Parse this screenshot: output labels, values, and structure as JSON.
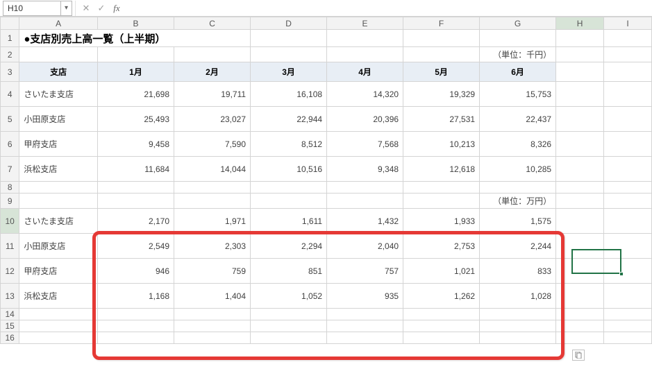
{
  "name_box": {
    "value": "H10"
  },
  "formula_bar": {
    "value": ""
  },
  "columns": [
    "A",
    "B",
    "C",
    "D",
    "E",
    "F",
    "G",
    "H",
    "I"
  ],
  "rows": [
    "1",
    "2",
    "3",
    "4",
    "5",
    "6",
    "7",
    "8",
    "9",
    "10",
    "11",
    "12",
    "13",
    "14",
    "15",
    "16"
  ],
  "title": "●支店別売上高一覧（上半期）",
  "unit_sen": "（単位：千円）",
  "unit_man": "（単位：万円）",
  "headers": {
    "store": "支店",
    "m1": "1月",
    "m2": "2月",
    "m3": "3月",
    "m4": "4月",
    "m5": "5月",
    "m6": "6月"
  },
  "data_sen": [
    {
      "store": "さいたま支店",
      "v": [
        "21,698",
        "19,711",
        "16,108",
        "14,320",
        "19,329",
        "15,753"
      ]
    },
    {
      "store": "小田原支店",
      "v": [
        "25,493",
        "23,027",
        "22,944",
        "20,396",
        "27,531",
        "22,437"
      ]
    },
    {
      "store": "甲府支店",
      "v": [
        "9,458",
        "7,590",
        "8,512",
        "7,568",
        "10,213",
        "8,326"
      ]
    },
    {
      "store": "浜松支店",
      "v": [
        "11,684",
        "14,044",
        "10,516",
        "9,348",
        "12,618",
        "10,285"
      ]
    }
  ],
  "data_man": [
    {
      "store": "さいたま支店",
      "v": [
        "2,170",
        "1,971",
        "1,611",
        "1,432",
        "1,933",
        "1,575"
      ]
    },
    {
      "store": "小田原支店",
      "v": [
        "2,549",
        "2,303",
        "2,294",
        "2,040",
        "2,753",
        "2,244"
      ]
    },
    {
      "store": "甲府支店",
      "v": [
        "946",
        "759",
        "851",
        "757",
        "1,021",
        "833"
      ]
    },
    {
      "store": "浜松支店",
      "v": [
        "1,168",
        "1,404",
        "1,052",
        "935",
        "1,262",
        "1,028"
      ]
    }
  ],
  "chart_data": {
    "type": "table",
    "title": "支店別売上高一覧（上半期）",
    "series_labels": [
      "1月",
      "2月",
      "3月",
      "4月",
      "5月",
      "6月"
    ],
    "unit_top": "千円",
    "rows_top": {
      "さいたま支店": [
        21698,
        19711,
        16108,
        14320,
        19329,
        15753
      ],
      "小田原支店": [
        25493,
        23027,
        22944,
        20396,
        27531,
        22437
      ],
      "甲府支店": [
        9458,
        7590,
        8512,
        7568,
        10213,
        8326
      ],
      "浜松支店": [
        11684,
        14044,
        10516,
        9348,
        12618,
        10285
      ]
    },
    "unit_bottom": "万円",
    "rows_bottom": {
      "さいたま支店": [
        2170,
        1971,
        1611,
        1432,
        1933,
        1575
      ],
      "小田原支店": [
        2549,
        2303,
        2294,
        2040,
        2753,
        2244
      ],
      "甲府支店": [
        946,
        759,
        851,
        757,
        1021,
        833
      ],
      "浜松支店": [
        1168,
        1404,
        1052,
        935,
        1262,
        1028
      ]
    }
  }
}
